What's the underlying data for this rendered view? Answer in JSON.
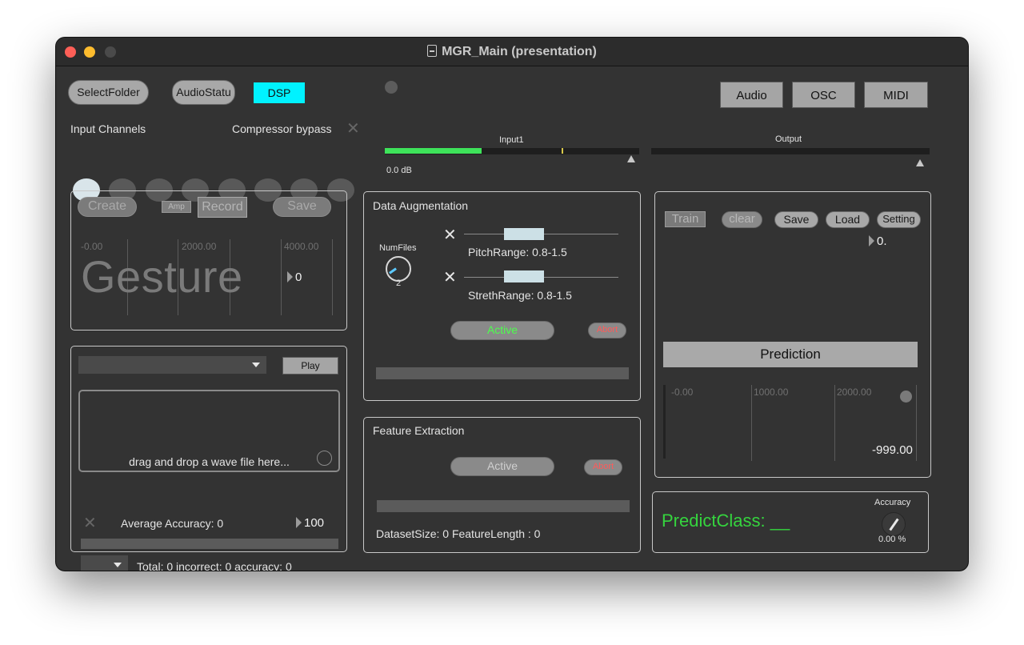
{
  "window": {
    "title": "MGR_Main (presentation)"
  },
  "toolbar": {
    "select_folder": "SelectFolder",
    "audio_status": "AudioStatu",
    "dsp": "DSP",
    "audio": "Audio",
    "osc": "OSC",
    "midi": "MIDI"
  },
  "inputs": {
    "channels_label": "Input Channels",
    "compressor_label": "Compressor bypass"
  },
  "meters": {
    "input_label": "Input1",
    "input_db": "0.0 dB",
    "input_level": 0.38,
    "output_label": "Output",
    "output_level": 0
  },
  "gesture_panel": {
    "create": "Create",
    "amp": "Amp",
    "record": "Record",
    "save": "Save",
    "watermark": "Gesture",
    "ticks": [
      "-0.00",
      "2000.00",
      "4000.00"
    ],
    "number": "0"
  },
  "playback_panel": {
    "play": "Play",
    "drop_hint": "drag and drop a wave file here...",
    "avg_accuracy": "Average Accuracy: 0",
    "number": "100",
    "totals": "Total: 0 incorrect: 0 accuracy: 0"
  },
  "augmentation": {
    "title": "Data Augmentation",
    "numfiles_label": "NumFiles",
    "numfiles_value": "2",
    "pitch_range": "PitchRange: 0.8-1.5",
    "streth_range": "StrethRange: 0.8-1.5",
    "active": "Active",
    "abort": "Abort"
  },
  "feature": {
    "title": "Feature Extraction",
    "active": "Active",
    "abort": "Abort",
    "dataset_info": "DatasetSize: 0 FeatureLength : 0"
  },
  "training": {
    "train": "Train",
    "clear": "clear",
    "save": "Save",
    "load": "Load",
    "setting": "Setting",
    "number": "0.",
    "prediction": "Prediction",
    "ticks": [
      "-0.00",
      "1000.00",
      "2000.00"
    ],
    "output_value": "-999.00"
  },
  "predict": {
    "class_label": "PredictClass: __",
    "accuracy_label": "Accuracy",
    "accuracy_value": "0.00 %"
  },
  "colors": {
    "accent_cyan": "#00f2ff",
    "meter_green": "#3ee35a",
    "predict_green": "#35d43e",
    "active_text": "#4dff4d",
    "abort_text": "#ff5a5a"
  }
}
